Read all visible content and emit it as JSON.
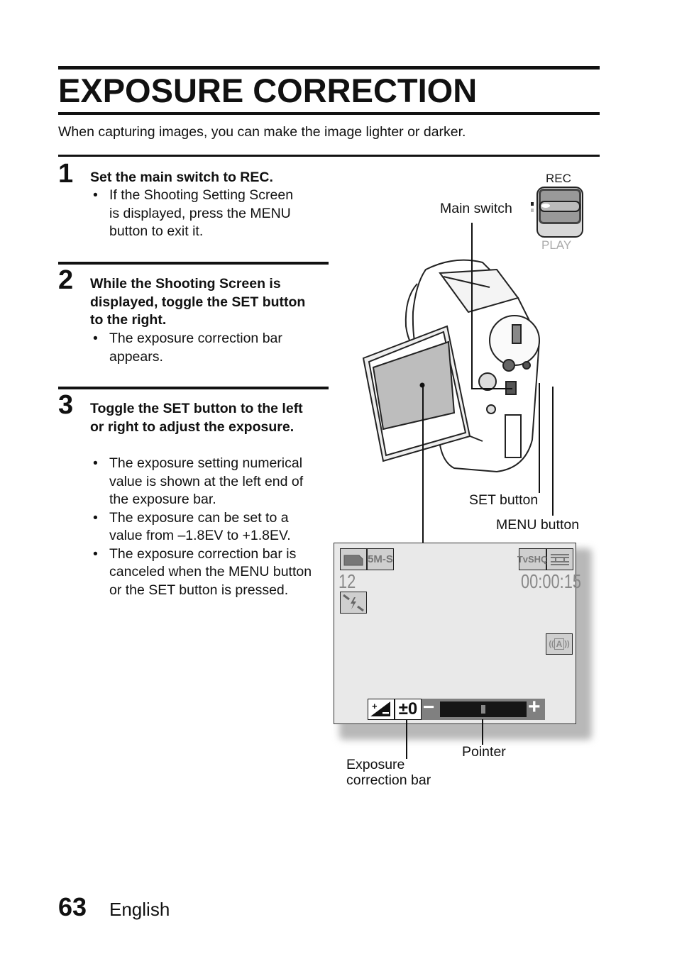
{
  "page": {
    "title": "EXPOSURE CORRECTION",
    "intro": "When capturing images, you can make the image lighter or darker.",
    "page_number": "63",
    "language": "English"
  },
  "steps": [
    {
      "number": "1",
      "heading": "Set the main switch to REC.",
      "bullets": [
        "If the Shooting Setting Screen is displayed, press the MENU button to exit it."
      ]
    },
    {
      "number": "2",
      "heading": "While the Shooting Screen is displayed, toggle the SET button to the right.",
      "bullets": [
        "The exposure correction bar appears."
      ]
    },
    {
      "number": "3",
      "heading": "Toggle the SET button to the left or right to adjust the exposure.",
      "bullets": [
        "The exposure setting numerical value is shown at the left end of the exposure bar.",
        "The exposure can be set to a value from –1.8EV to +1.8EV.",
        "The exposure correction bar is canceled when the MENU button or the SET button is pressed."
      ]
    }
  ],
  "illustration": {
    "switch": {
      "rec_label": "REC",
      "play_label": "PLAY",
      "position": "REC"
    },
    "callouts": {
      "main_switch": "Main switch",
      "set_button": "SET button",
      "menu_button": "MENU button",
      "pointer": "Pointer",
      "exposure_bar": "Exposure correction bar"
    },
    "lcd": {
      "resolution_badge": "5M-S",
      "quality_badge": "TvSHQ",
      "remaining_shots": "12",
      "timecode": "00:00:15",
      "exposure_value": "±0",
      "exposure_ev": 0,
      "exposure_range_ev": [
        -1.8,
        1.8
      ],
      "minus_glyph": "−",
      "plus_glyph": "+",
      "stabilizer_letter": "A"
    }
  }
}
